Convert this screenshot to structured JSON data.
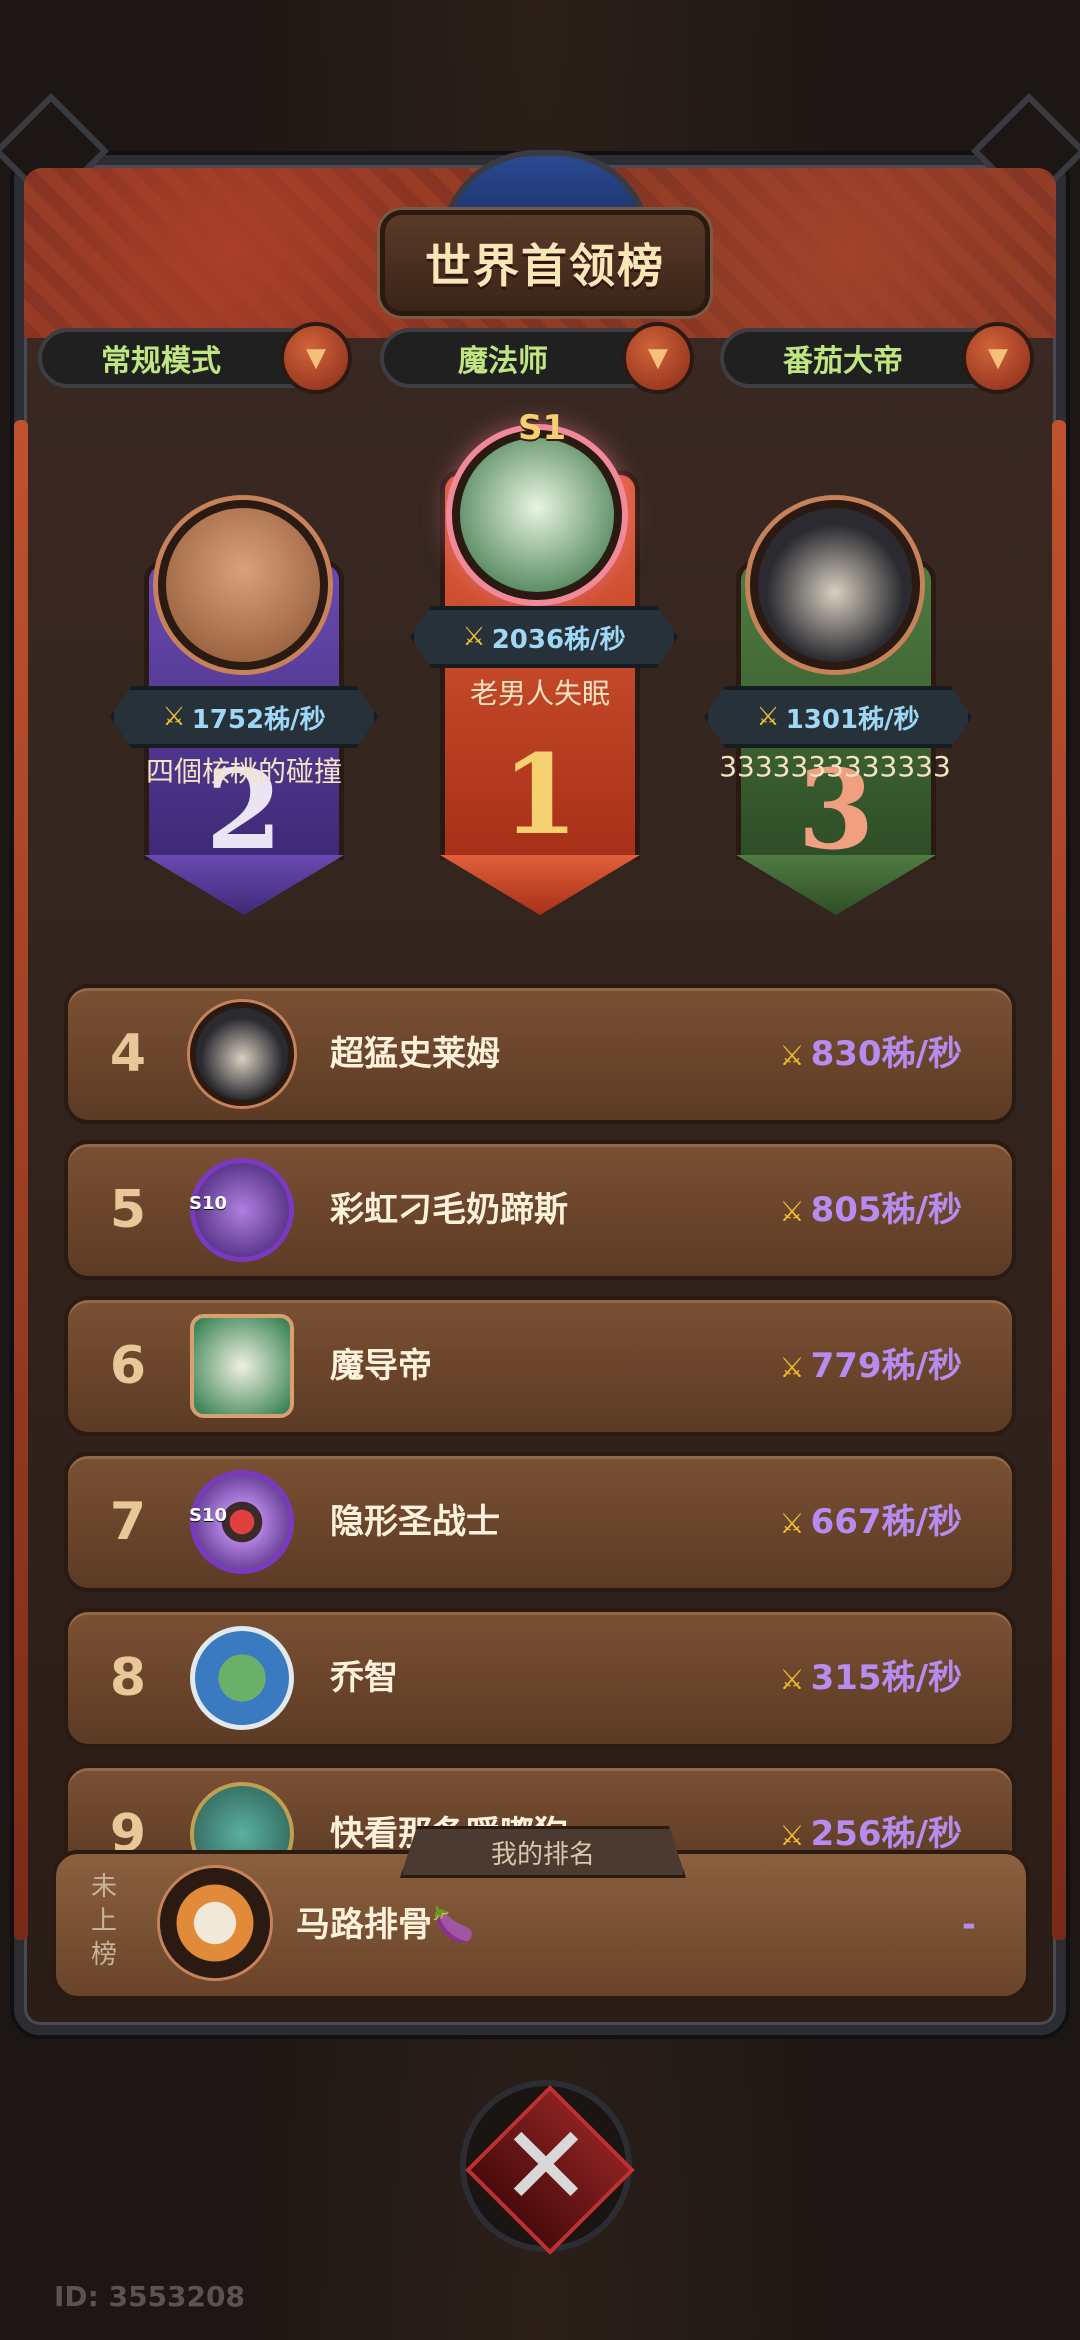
{
  "header": {
    "title": "世界首领榜"
  },
  "filters": [
    {
      "label": "常规模式",
      "icon": "dropdown-arrow"
    },
    {
      "label": "魔法师",
      "icon": "dropdown-arrow"
    },
    {
      "label": "番茄大帝",
      "icon": "dropdown-arrow"
    }
  ],
  "podium": {
    "first": {
      "rank": "1",
      "name": "老男人失眠",
      "score": "2036秭/秒",
      "badge": "S1"
    },
    "second": {
      "rank": "2",
      "name": "四個核桃的碰撞",
      "score": "1752秭/秒"
    },
    "third": {
      "rank": "3",
      "name": "3333333333333",
      "score": "1301秭/秒"
    }
  },
  "rows": [
    {
      "rank": "4",
      "name": "超猛史莱姆",
      "score": "830秭/秒"
    },
    {
      "rank": "5",
      "name": "彩虹刁毛奶蹄斯",
      "score": "805秭/秒",
      "badge": "S10"
    },
    {
      "rank": "6",
      "name": "魔导帝",
      "score": "779秭/秒"
    },
    {
      "rank": "7",
      "name": "隐形圣战士",
      "score": "667秭/秒",
      "badge": "S10"
    },
    {
      "rank": "8",
      "name": "乔智",
      "score": "315秭/秒"
    },
    {
      "rank": "9",
      "name": "快看那条暖嘟狗",
      "score": "256秭/秒"
    }
  ],
  "my_rank": {
    "tab_label": "我的排名",
    "status_chars": [
      "未",
      "上",
      "榜"
    ],
    "name": "马路排骨🍆",
    "score": "-"
  },
  "footer": {
    "user_id": "ID: 3553208"
  },
  "colors": {
    "score_purple": "#b68cf0",
    "score_blue": "#9fd8f6",
    "filter_green": "#bfe680",
    "pillar_gold": "#d4502a",
    "pillar_purple": "#5a3a9a",
    "pillar_green": "#3f6a35"
  }
}
